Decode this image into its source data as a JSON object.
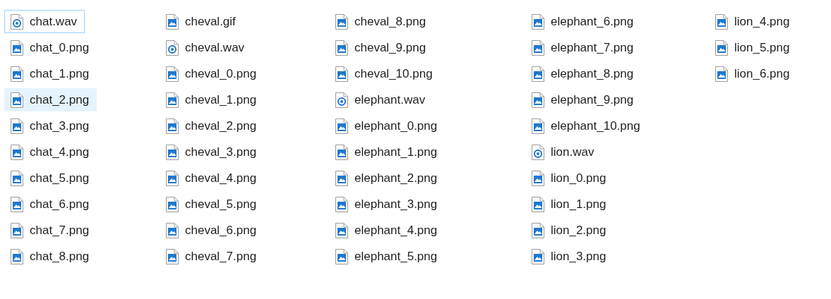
{
  "files": [
    {
      "name": "chat.wav",
      "kind": "audio",
      "focused": true,
      "hovered": false
    },
    {
      "name": "chat_0.png",
      "kind": "image",
      "focused": false,
      "hovered": false
    },
    {
      "name": "chat_1.png",
      "kind": "image",
      "focused": false,
      "hovered": false
    },
    {
      "name": "chat_2.png",
      "kind": "image",
      "focused": false,
      "hovered": true
    },
    {
      "name": "chat_3.png",
      "kind": "image",
      "focused": false,
      "hovered": false
    },
    {
      "name": "chat_4.png",
      "kind": "image",
      "focused": false,
      "hovered": false
    },
    {
      "name": "chat_5.png",
      "kind": "image",
      "focused": false,
      "hovered": false
    },
    {
      "name": "chat_6.png",
      "kind": "image",
      "focused": false,
      "hovered": false
    },
    {
      "name": "chat_7.png",
      "kind": "image",
      "focused": false,
      "hovered": false
    },
    {
      "name": "chat_8.png",
      "kind": "image",
      "focused": false,
      "hovered": false
    },
    {
      "name": "cheval.gif",
      "kind": "image",
      "focused": false,
      "hovered": false
    },
    {
      "name": "cheval.wav",
      "kind": "audio",
      "focused": false,
      "hovered": false
    },
    {
      "name": "cheval_0.png",
      "kind": "image",
      "focused": false,
      "hovered": false
    },
    {
      "name": "cheval_1.png",
      "kind": "image",
      "focused": false,
      "hovered": false
    },
    {
      "name": "cheval_2.png",
      "kind": "image",
      "focused": false,
      "hovered": false
    },
    {
      "name": "cheval_3.png",
      "kind": "image",
      "focused": false,
      "hovered": false
    },
    {
      "name": "cheval_4.png",
      "kind": "image",
      "focused": false,
      "hovered": false
    },
    {
      "name": "cheval_5.png",
      "kind": "image",
      "focused": false,
      "hovered": false
    },
    {
      "name": "cheval_6.png",
      "kind": "image",
      "focused": false,
      "hovered": false
    },
    {
      "name": "cheval_7.png",
      "kind": "image",
      "focused": false,
      "hovered": false
    },
    {
      "name": "cheval_8.png",
      "kind": "image",
      "focused": false,
      "hovered": false
    },
    {
      "name": "cheval_9.png",
      "kind": "image",
      "focused": false,
      "hovered": false
    },
    {
      "name": "cheval_10.png",
      "kind": "image",
      "focused": false,
      "hovered": false
    },
    {
      "name": "elephant.wav",
      "kind": "audio",
      "focused": false,
      "hovered": false
    },
    {
      "name": "elephant_0.png",
      "kind": "image",
      "focused": false,
      "hovered": false
    },
    {
      "name": "elephant_1.png",
      "kind": "image",
      "focused": false,
      "hovered": false
    },
    {
      "name": "elephant_2.png",
      "kind": "image",
      "focused": false,
      "hovered": false
    },
    {
      "name": "elephant_3.png",
      "kind": "image",
      "focused": false,
      "hovered": false
    },
    {
      "name": "elephant_4.png",
      "kind": "image",
      "focused": false,
      "hovered": false
    },
    {
      "name": "elephant_5.png",
      "kind": "image",
      "focused": false,
      "hovered": false
    },
    {
      "name": "elephant_6.png",
      "kind": "image",
      "focused": false,
      "hovered": false
    },
    {
      "name": "elephant_7.png",
      "kind": "image",
      "focused": false,
      "hovered": false
    },
    {
      "name": "elephant_8.png",
      "kind": "image",
      "focused": false,
      "hovered": false
    },
    {
      "name": "elephant_9.png",
      "kind": "image",
      "focused": false,
      "hovered": false
    },
    {
      "name": "elephant_10.png",
      "kind": "image",
      "focused": false,
      "hovered": false
    },
    {
      "name": "lion.wav",
      "kind": "audio",
      "focused": false,
      "hovered": false
    },
    {
      "name": "lion_0.png",
      "kind": "image",
      "focused": false,
      "hovered": false
    },
    {
      "name": "lion_1.png",
      "kind": "image",
      "focused": false,
      "hovered": false
    },
    {
      "name": "lion_2.png",
      "kind": "image",
      "focused": false,
      "hovered": false
    },
    {
      "name": "lion_3.png",
      "kind": "image",
      "focused": false,
      "hovered": false
    },
    {
      "name": "lion_4.png",
      "kind": "image",
      "focused": false,
      "hovered": false
    },
    {
      "name": "lion_5.png",
      "kind": "image",
      "focused": false,
      "hovered": false
    },
    {
      "name": "lion_6.png",
      "kind": "image",
      "focused": false,
      "hovered": false
    }
  ]
}
